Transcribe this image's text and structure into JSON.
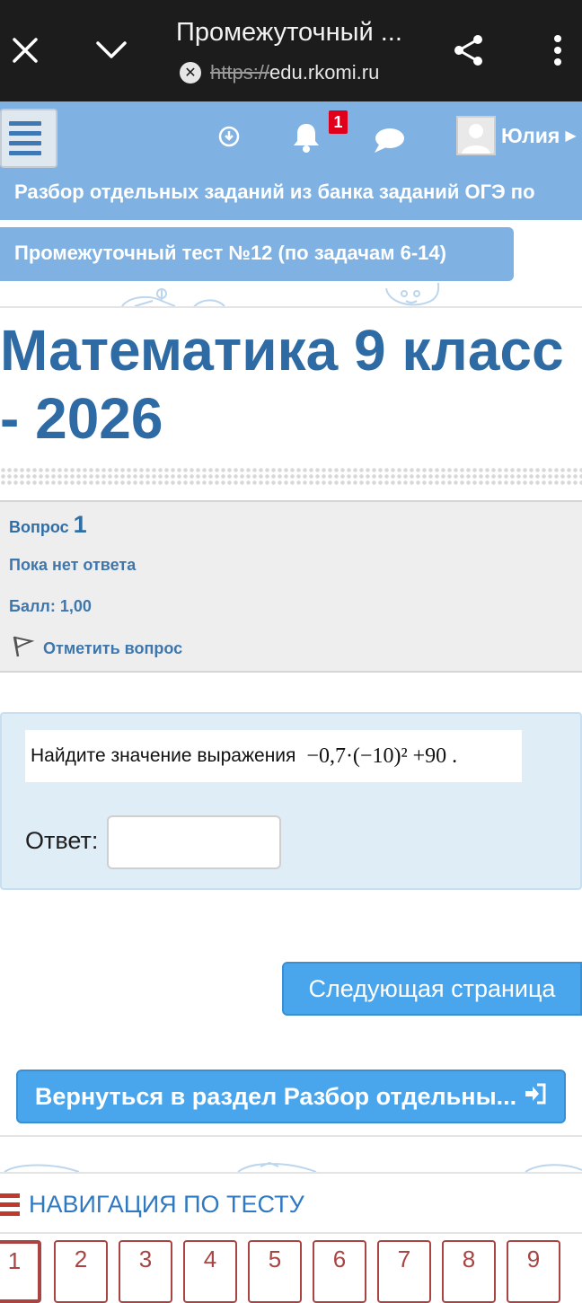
{
  "browser": {
    "title": "Промежуточный ...",
    "url_scheme": "https://",
    "url_host": "edu.rkomi.ru"
  },
  "topnav": {
    "notification_count": "1",
    "user_name": "Юлия"
  },
  "breadcrumb": {
    "section": "Разбор отдельных заданий из банка заданий ОГЭ по",
    "quiz": "Промежуточный тест №12 (по задачам 6-14)"
  },
  "course": {
    "title_line1": "Математика 9 класс",
    "title_line2": "- 2026"
  },
  "question": {
    "label": "Вопрос",
    "number": "1",
    "state": "Пока нет ответа",
    "grade": "Балл: 1,00",
    "flag_label": "Отметить вопрос",
    "text": "Найдите значение выражения",
    "expression": "−0,7·(−10)² +90 .",
    "answer_label": "Ответ:",
    "answer_value": ""
  },
  "buttons": {
    "next_page": "Следующая страница",
    "return": "Вернуться в раздел Разбор отдельны..."
  },
  "navigation": {
    "title": "НАВИГАЦИЯ ПО ТЕСТУ",
    "items": [
      "1",
      "2",
      "3",
      "4",
      "5",
      "6",
      "7",
      "8",
      "9"
    ]
  },
  "colors": {
    "header_blue": "#7fb1e2",
    "title_blue": "#2e6ba4",
    "button_blue": "#4aa6ec",
    "nav_red": "#a94442"
  }
}
